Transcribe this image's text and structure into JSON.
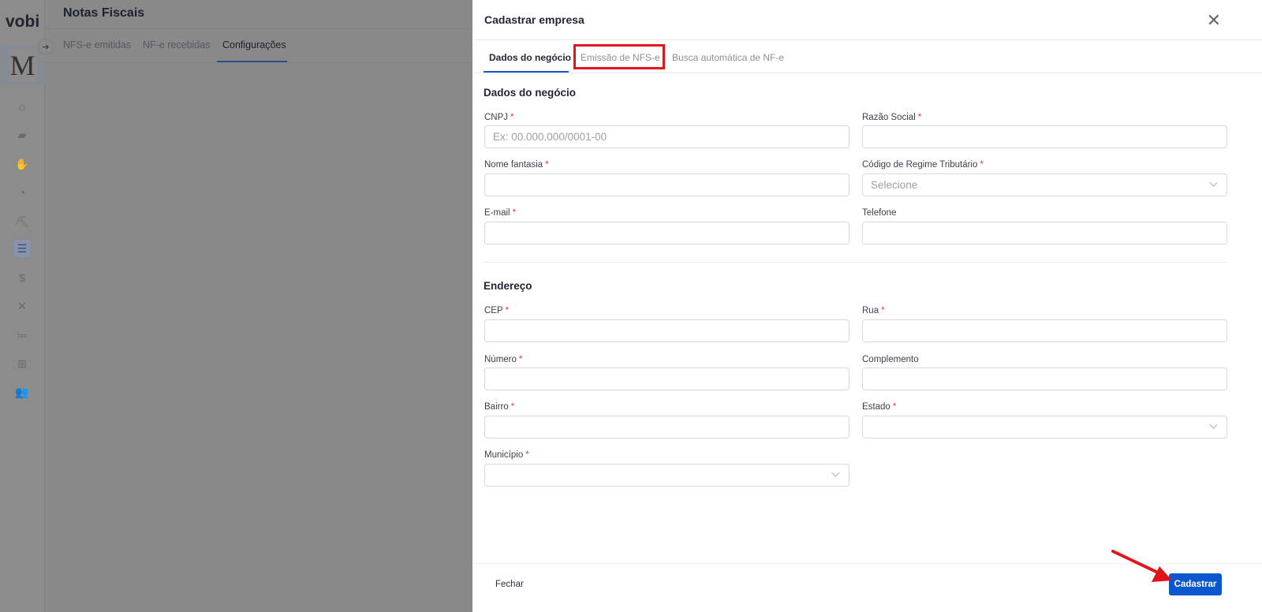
{
  "app": {
    "logo": "vobi",
    "avatar_letter": "M",
    "page_title": "Notas Fiscais",
    "tabs": [
      {
        "label": "NFS-e emitidas"
      },
      {
        "label": "NF-e recebidas"
      },
      {
        "label": "Configurações",
        "active": true
      }
    ],
    "sidebar_icons": [
      "home-icon",
      "folder-icon",
      "handshake-icon",
      "gauge-icon",
      "worker-icon",
      "database-icon",
      "dollar-icon",
      "tools-icon",
      "list-icon",
      "apps-add-icon",
      "team-icon"
    ],
    "active_sidebar_icon": "database-icon"
  },
  "drawer": {
    "title": "Cadastrar empresa",
    "tabs": [
      {
        "label": "Dados do negócio",
        "active": true
      },
      {
        "label": "Emissão de NFS-e"
      },
      {
        "label": "Busca automática de NF-e"
      }
    ],
    "section1": "Dados do negócio",
    "section2": "Endereço",
    "fields": {
      "cnpj": {
        "label": "CNPJ",
        "required": "*",
        "placeholder": "Ex: 00.000.000/0001-00"
      },
      "razao": {
        "label": "Razão Social",
        "required": "*"
      },
      "nome": {
        "label": "Nome fantasia",
        "required": "*"
      },
      "regime": {
        "label": "Código de Regime Tributário",
        "required": "*",
        "placeholder": "Selecione"
      },
      "email": {
        "label": "E-mail",
        "required": "*"
      },
      "telefone": {
        "label": "Telefone"
      },
      "cep": {
        "label": "CEP",
        "required": "*"
      },
      "rua": {
        "label": "Rua",
        "required": "*"
      },
      "numero": {
        "label": "Número",
        "required": "*"
      },
      "complemento": {
        "label": "Complemento"
      },
      "bairro": {
        "label": "Bairro",
        "required": "*"
      },
      "estado": {
        "label": "Estado",
        "required": "*"
      },
      "municipio": {
        "label": "Município",
        "required": "*"
      }
    },
    "close_label": "Fechar",
    "submit_label": "Cadastrar"
  },
  "colors": {
    "primary": "#0b57d0",
    "annotation": "#e0141a",
    "required": "#e53935"
  }
}
